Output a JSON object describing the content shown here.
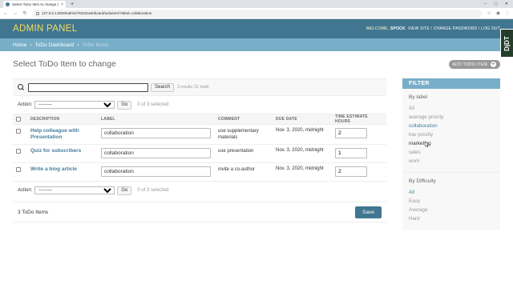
{
  "browser": {
    "tab_title": "Select ToDo Item to change | D",
    "tab_close": "×",
    "new_tab": "+",
    "url": "127.0.0.1:8000/admin/ToDoDashboard/todoitem/?label=collaboration",
    "window_controls": [
      "–",
      "▢",
      "✕"
    ]
  },
  "header": {
    "branding": "ADMIN PANEL",
    "welcome_prefix": "WELCOME, ",
    "username": "SPOCK",
    "sep": ". ",
    "view_site": "VIEW SITE",
    "slash1": " / ",
    "change_password": "CHANGE PASSWORD",
    "slash2": " / ",
    "log_out": "LOG OUT"
  },
  "breadcrumbs": {
    "home": "Home",
    "sep": "›",
    "app": "ToDo Dashboard",
    "current": "ToDo Items"
  },
  "djdt": "DjDT",
  "page": {
    "title": "Select ToDo Item to change",
    "add_label": "ADD TODO ITEM",
    "add_plus": "+"
  },
  "search": {
    "button": "Search",
    "result_note": "3 results (11 total)"
  },
  "actions": {
    "label": "Action:",
    "select_value": "---------",
    "go": "Go",
    "counter": "0 of 3 selected"
  },
  "table": {
    "headers": [
      "DESCRIPTION",
      "LABEL",
      "COMMENT",
      "DUE DATE",
      "TIME ESTIMATE HOURS"
    ],
    "rows": [
      {
        "description": "Help colleague with Presentation",
        "label": "collaboration",
        "comment": "use supplementary materials",
        "due": "Nov. 3, 2020, midnight",
        "hours": "2"
      },
      {
        "description": "Quiz for subscribers",
        "label": "collaboration",
        "comment": "use presentation",
        "due": "Nov. 3, 2020, midnight",
        "hours": "1"
      },
      {
        "description": "Write a blog article",
        "label": "collaboration",
        "comment": "invite a co-author",
        "due": "Nov. 3, 2020, midnight",
        "hours": "2"
      }
    ]
  },
  "paginator": {
    "count": "3 ToDo Items",
    "save": "Save"
  },
  "filter": {
    "title": "FILTER",
    "by_label": "By label",
    "label_options": [
      "All",
      "average priority",
      "collaboration",
      "low priority",
      "marketing",
      "sales",
      "work"
    ],
    "by_difficulty": "By Difficulty",
    "difficulty_options": [
      "All",
      "Easy",
      "Average",
      "Hard"
    ]
  },
  "colors": {
    "header": "#417690",
    "breadcrumbs": "#79aec8",
    "branding": "#f5dd5d",
    "link": "#447e9b"
  }
}
